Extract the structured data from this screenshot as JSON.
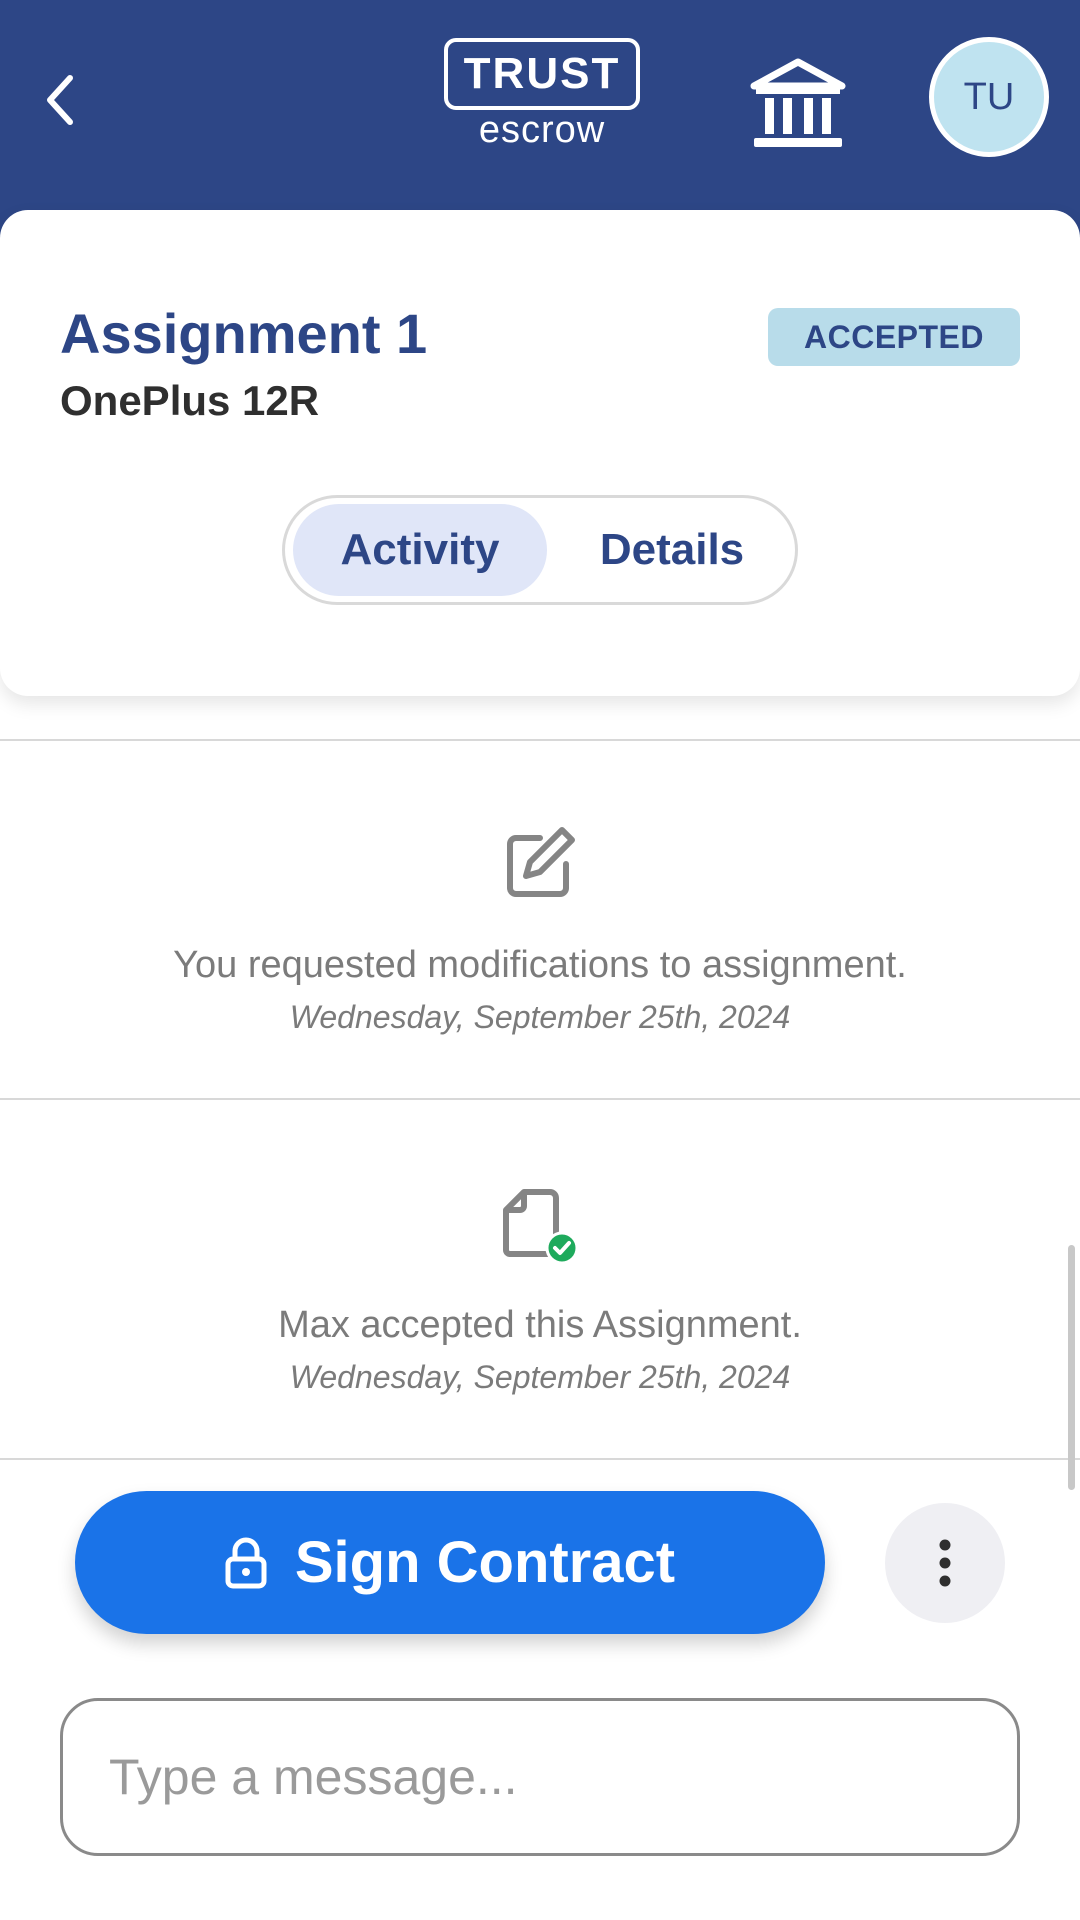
{
  "header": {
    "logo_top": "TRUST",
    "logo_bottom": "escrow",
    "avatar_initials": "TU",
    "icons": {
      "back": "chevron-left-icon",
      "bank": "bank-icon"
    },
    "background_color": "#2d4686"
  },
  "assignment": {
    "title": "Assignment 1",
    "subtitle": "OnePlus 12R",
    "status": "ACCEPTED"
  },
  "tabs": [
    {
      "label": "Activity",
      "active": true
    },
    {
      "label": "Details",
      "active": false
    }
  ],
  "activity": [
    {
      "icon": "edit-icon",
      "text": "You requested modifications to assignment.",
      "date": "Wednesday, September 25th, 2024"
    },
    {
      "icon": "document-check-icon",
      "text": "Max accepted this Assignment.",
      "date": "Wednesday, September 25th, 2024"
    }
  ],
  "actions": {
    "sign_label": "Sign Contract",
    "sign_icon": "lock-icon",
    "more_icon": "more-vertical-icon",
    "accent_color": "#1a73e8"
  },
  "message": {
    "placeholder": "Type a message...",
    "value": ""
  }
}
